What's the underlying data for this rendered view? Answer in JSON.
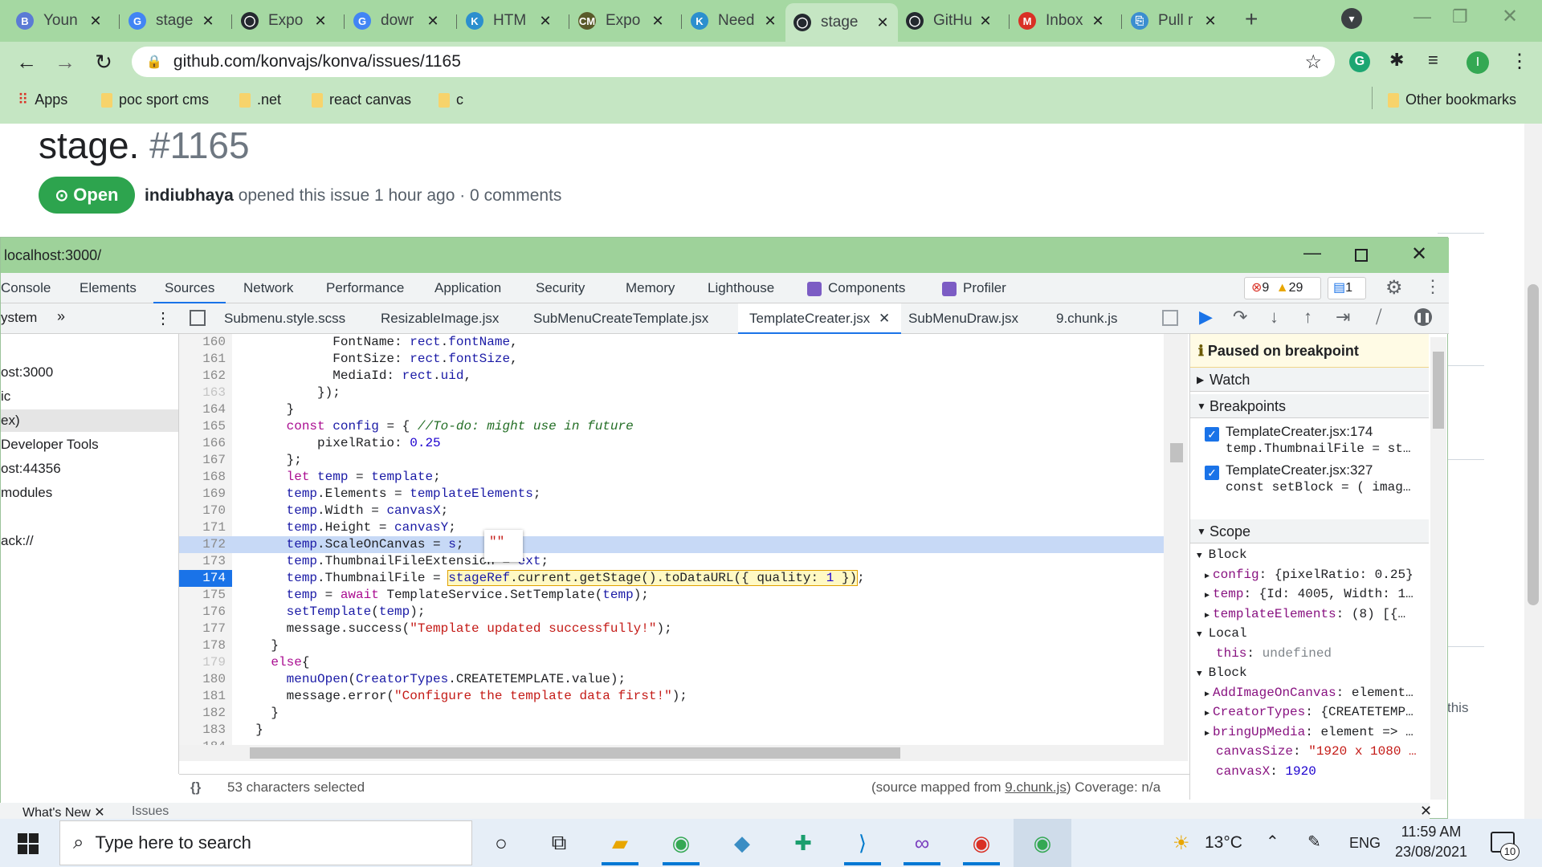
{
  "browser": {
    "tabs": [
      {
        "title": "Youn",
        "color": "#5b7bd5",
        "glyph": "B"
      },
      {
        "title": "stage",
        "color": "#4285f4",
        "glyph": "G"
      },
      {
        "title": "Expo",
        "color": "#24292f",
        "glyph": "◯"
      },
      {
        "title": "dowr",
        "color": "#4285f4",
        "glyph": "G"
      },
      {
        "title": "HTM",
        "color": "#2c8fce",
        "glyph": "K"
      },
      {
        "title": "Expo",
        "color": "#5a5a2a",
        "glyph": "CM"
      },
      {
        "title": "Need",
        "color": "#2c8fce",
        "glyph": "K"
      },
      {
        "title": "stage",
        "color": "#24292f",
        "glyph": "◯",
        "active": true
      },
      {
        "title": "GitHu",
        "color": "#24292f",
        "glyph": "◯"
      },
      {
        "title": "Inbox",
        "color": "#d93025",
        "glyph": "M"
      },
      {
        "title": "Pull r",
        "color": "#3b8ed0",
        "glyph": "⎘"
      }
    ],
    "url": "github.com/konvajs/konva/issues/1165",
    "bookmarks": [
      "Apps",
      "poc sport cms",
      ".net",
      "react canvas",
      "c"
    ],
    "other_bookmarks": "Other bookmarks",
    "profile_initial": "I"
  },
  "github": {
    "title": "stage.",
    "issue_number": "#1165",
    "state": "Open",
    "author": "indiubhaya",
    "meta": " opened this issue 1 hour ago · 0 comments",
    "side_text": "this"
  },
  "devtools": {
    "window_title": "localhost:3000/",
    "panel_tabs": [
      "Console",
      "Elements",
      "Sources",
      "Network",
      "Performance",
      "Application",
      "Security",
      "Memory",
      "Lighthouse",
      "Components",
      "Profiler"
    ],
    "errors": "9",
    "warnings": "29",
    "issues": "1",
    "navigator_label": "ystem",
    "navigator_items": [
      "",
      "ost:3000",
      "ic",
      "ex)",
      "Developer Tools",
      "ost:44356",
      "modules",
      "",
      "ack://"
    ],
    "file_tabs": [
      "Submenu.style.scss",
      "ResizableImage.jsx",
      "SubMenuCreateTemplate.jsx",
      "TemplateCreater.jsx",
      "SubMenuDraw.jsx",
      "9.chunk.js"
    ],
    "code_lines": [
      {
        "n": "160",
        "html": "            FontName: <span class='prop'>rect</span>.<span class='prop'>fontName</span>,"
      },
      {
        "n": "161",
        "html": "            FontSize: <span class='prop'>rect</span>.<span class='prop'>fontSize</span>,"
      },
      {
        "n": "162",
        "html": "            MediaId: <span class='prop'>rect</span>.<span class='prop'>uid</span>,"
      },
      {
        "n": "163",
        "html": "          });",
        "dim": true
      },
      {
        "n": "164",
        "html": "      }"
      },
      {
        "n": "165",
        "html": "      <span class='kw'>const</span> <span class='prop'>config</span> = { <span class='cm'>//To-do: might use in future</span>"
      },
      {
        "n": "166",
        "html": "          pixelRatio: <span class='num'>0.25</span>"
      },
      {
        "n": "167",
        "html": "      };"
      },
      {
        "n": "168",
        "html": "      <span class='kw'>let</span> <span class='prop'>temp</span> = <span class='prop'>template</span>;"
      },
      {
        "n": "169",
        "html": "      <span class='prop'>temp</span>.Elements = <span class='prop'>templateElements</span>;"
      },
      {
        "n": "170",
        "html": "      <span class='prop'>temp</span>.Width = <span class='prop'>canvasX</span>;"
      },
      {
        "n": "171",
        "html": "      <span class='prop'>temp</span>.Height = <span class='prop'>canvasY</span>;"
      },
      {
        "n": "172",
        "html": "      <span class='prop'>temp</span>.ScaleOnCanvas = <span class='prop'>s</span>;",
        "hl": true
      },
      {
        "n": "173",
        "html": "      <span class='prop'>temp</span>.ThumbnailFileExtension = <span class='prop'>ext</span>;"
      },
      {
        "n": "174",
        "html": "      <span class='prop'>temp</span>.ThumbnailFile = <span style='background:#fff9c4;outline:1px solid #e0a000'><span class='prop'>stageRef</span>.current.getStage().toDataURL({ quality: <span class='num'>1</span> })</span>;",
        "bp": true
      },
      {
        "n": "175",
        "html": "      <span class='prop'>temp</span> = <span class='kw'>await</span> TemplateService.SetTemplate(<span class='prop'>temp</span>);"
      },
      {
        "n": "176",
        "html": "      <span class='fn'>setTemplate</span>(<span class='prop'>temp</span>);"
      },
      {
        "n": "177",
        "html": "      message.success(<span class='str'>\"Template updated successfully!\"</span>);"
      },
      {
        "n": "178",
        "html": "    }"
      },
      {
        "n": "179",
        "html": "    <span class='kw'>else</span>{",
        "dim": true
      },
      {
        "n": "180",
        "html": "      <span class='fn'>menuOpen</span>(<span class='prop'>CreatorTypes</span>.CREATETEMPLATE.value);"
      },
      {
        "n": "181",
        "html": "      message.error(<span class='str'>\"Configure the template data first!\"</span>);"
      },
      {
        "n": "182",
        "html": "    }"
      },
      {
        "n": "183",
        "html": "  }"
      },
      {
        "n": "184",
        "html": ""
      }
    ],
    "tooltip_value": "\"\"",
    "status_left": "53 characters selected",
    "status_right_prefix": "(source mapped from ",
    "status_link": "9.chunk.js",
    "status_right_suffix": ")  Coverage: n/a",
    "paused": "Paused on breakpoint",
    "watch": "Watch",
    "breakpoints_label": "Breakpoints",
    "breakpoints": [
      {
        "file": "TemplateCreater.jsx:174",
        "code": "temp.ThumbnailFile = st…"
      },
      {
        "file": "TemplateCreater.jsx:327",
        "code": "const setBlock = ( imag…"
      }
    ],
    "scope": "Scope",
    "scope_rows": [
      {
        "t": "header",
        "text": "Block"
      },
      {
        "t": "item",
        "k": "config",
        "v": "{pixelRatio: 0.25}",
        "exp": true
      },
      {
        "t": "item",
        "k": "temp",
        "v": "{Id: 4005, Width: 1…",
        "exp": true
      },
      {
        "t": "item",
        "k": "templateElements",
        "v": "(8) [{…",
        "exp": true
      },
      {
        "t": "header",
        "text": "Local"
      },
      {
        "t": "item",
        "k": "this",
        "v": "undefined",
        "exp": false
      },
      {
        "t": "header",
        "text": "Block"
      },
      {
        "t": "item",
        "k": "AddImageOnCanvas",
        "v": "element…",
        "exp": true
      },
      {
        "t": "item",
        "k": "CreatorTypes",
        "v": "{CREATETEMP…",
        "exp": true
      },
      {
        "t": "item",
        "k": "bringUpMedia",
        "v": "element => …",
        "exp": true
      },
      {
        "t": "item",
        "k": "canvasSize",
        "v": "\"1920 x 1080 …",
        "exp": false
      },
      {
        "t": "item",
        "k": "canvasX",
        "v": "1920",
        "exp": false
      }
    ],
    "drawer_tabs": [
      "What's New",
      "Issues"
    ]
  },
  "taskbar": {
    "search_placeholder": "Type here to search",
    "weather": "13°C",
    "lang": "ENG",
    "time": "11:59 AM",
    "date": "23/08/2021",
    "notifications": "10"
  }
}
